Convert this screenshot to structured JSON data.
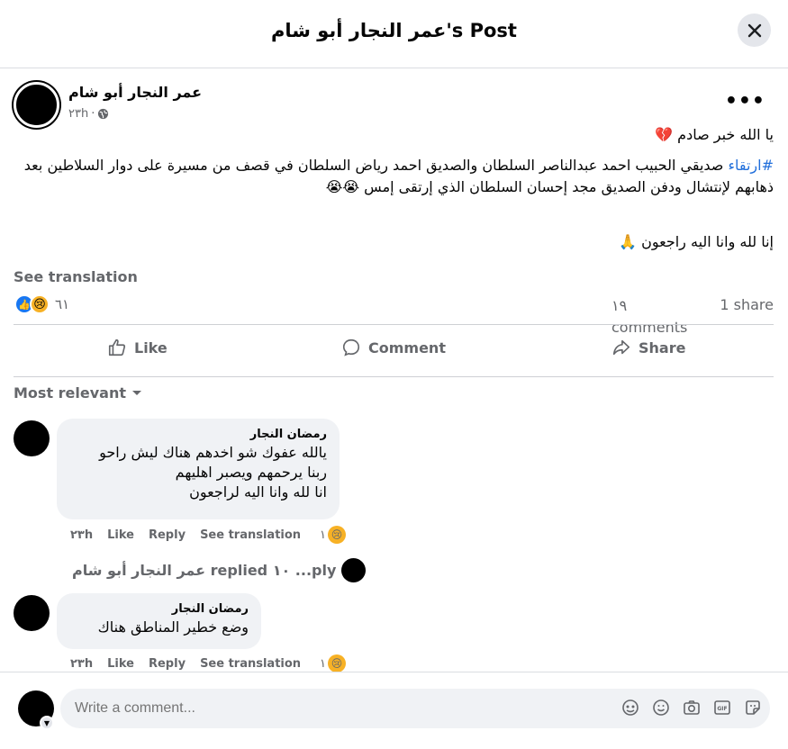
{
  "header": {
    "title": "عمر النجار أبو شام's Post"
  },
  "post": {
    "author": "عمر النجار أبو شام",
    "time": "٢٣h",
    "line1": "يا الله خبر صادم 💔",
    "hashtag": "#ارتقاء",
    "line2": "صديقي الحبيب احمد عبدالناصر السلطان والصديق احمد رياض السلطان في قصف من مسيرة على دوار السلاطين بعد ذهابهم لإنتشال ودفن الصديق مجد إحسان السلطان الذي إرتقى إمس 😭😭",
    "line3": "إنا لله وانا اليه راجعون 🙏",
    "see_translation": "See translation",
    "reaction_count": "٦١",
    "comments_count": "١٩ comments",
    "shares": "1 share"
  },
  "actions": {
    "like": "Like",
    "comment": "Comment",
    "share": "Share"
  },
  "filter": {
    "label": "Most relevant"
  },
  "comments": [
    {
      "name": "رمضان النجار",
      "text": "يالله عفوك شو اخدهم هناك ليش راحو\nربنا يرحمهم ويصبر اهليهم\nانا لله وانا اليه لراجعون",
      "time": "٢٣h",
      "like": "Like",
      "reply": "Reply",
      "see_translation": "See translation",
      "reactions": "١"
    },
    {
      "name": "رمضان النجار",
      "text": "وضع خطير المناطق هناك",
      "time": "٢٣h",
      "like": "Like",
      "reply": "Reply",
      "see_translation": "See translation",
      "reactions": "١"
    }
  ],
  "replies": {
    "text": "عمر النجار أبو شام replied ١٠ ...ply"
  },
  "composer": {
    "placeholder": "Write a comment..."
  }
}
